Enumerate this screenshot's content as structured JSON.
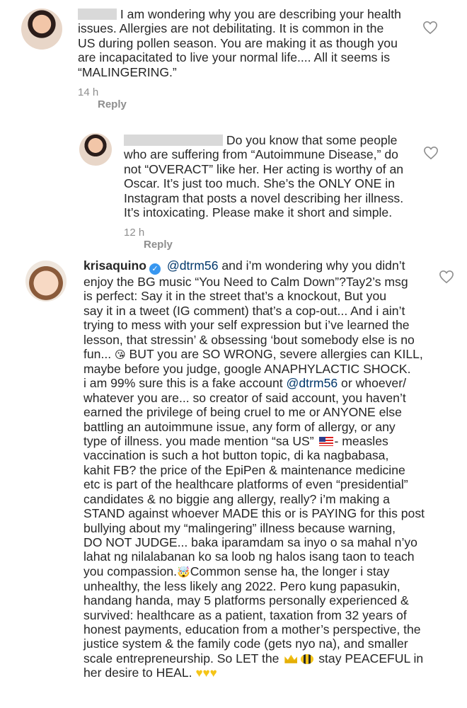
{
  "comments": [
    {
      "id": "c1",
      "lines": [
        "I am wondering why you are describing your health",
        "issues. Allergies are not debilitating. It is common in the",
        "US during pollen season. You are making it as though you",
        "are incapacitated to live your normal life.... All it seems is",
        "“MALINGERING.”"
      ],
      "time": "14 h",
      "reply_label": "Reply"
    },
    {
      "id": "c2",
      "lines": [
        "Do you know that some people",
        "who are suffering from “Autoimmune Disease,” do",
        "not “OVERACT” like her. Her acting is worthy of an",
        "Oscar. It’s just too much. She’s the ONLY ONE in",
        "Instagram that posts a novel describing her illness.",
        "It’s intoxicating. Please make it short and simple."
      ],
      "time": "12 h",
      "reply_label": "Reply"
    },
    {
      "id": "c3",
      "username": "krisaquino",
      "mention": "@dtrm56",
      "first_line_rest": " and i’m wondering why you didn’t",
      "lines": [
        "enjoy the BG music “You Need to Calm Down”?Tay2’s msg",
        "is perfect: Say it in the street that’s a knockout, But you",
        "say it in a tweet (IG comment) that’s a cop-out... And i ain’t",
        "trying to mess with your self expression but i’ve learned the",
        "lesson, that stressin’ & obsessing ‘bout somebody else is no",
        "fun...",
        "BUT you are SO WRONG, severe allergies can KILL,",
        "maybe before you judge, google ANAPHYLACTIC SHOCK.",
        "i am 99% sure this is a fake account",
        "or whoever/",
        "whatever you are... so creator of said account, you haven’t",
        "earned the privilege of being cruel to me or ANYONE else",
        "battling an autoimmune issue, any form of allergy, or any",
        "type of illness. you made mention “sa US”",
        "- measles",
        "vaccination is such a hot button topic, di ka nagbabasa,",
        "kahit FB? the price of the EpiPen & maintenance medicine",
        "etc is part of the healthcare platforms of even “presidential”",
        "candidates & no biggie ang allergy, really? i’m making a",
        "STAND against whoever MADE this or is PAYING for this post",
        "bullying about my “malingering” illness because warning,",
        "DO NOT JUDGE... baka iparamdam sa inyo o sa mahal n’yo",
        "lahat ng nilalabanan ko sa loob ng halos isang taon to teach",
        "you compassion.",
        "Common sense ha, the longer i stay",
        "unhealthy, the less likely ang 2022. Pero kung papasukin,",
        "handang handa, may 5 platforms personally experienced &",
        "survived: healthcare as a patient, taxation from 32 years of",
        "honest payments, education from a mother’s perspective, the",
        "justice system & the family code (gets nyo na), and smaller",
        "scale entrepreneurship. So LET the",
        "stay PEACEFUL in",
        "her desire to HEAL."
      ],
      "mention2": "@dtrm56"
    }
  ],
  "icons": {
    "heart": "heart-outline-icon",
    "verified": "verified-badge-icon",
    "kiss_emoji": "kissing-face-emoji",
    "us_flag": "us-flag-emoji",
    "angry_emoji": "exploding-head-emoji",
    "crown": "crown-emoji",
    "bee": "bee-emoji",
    "yellow_heart": "yellow-heart-emoji"
  },
  "colors": {
    "text": "#262626",
    "meta": "#8e8e8e",
    "mention": "#00376b",
    "verified": "#3897f0"
  }
}
